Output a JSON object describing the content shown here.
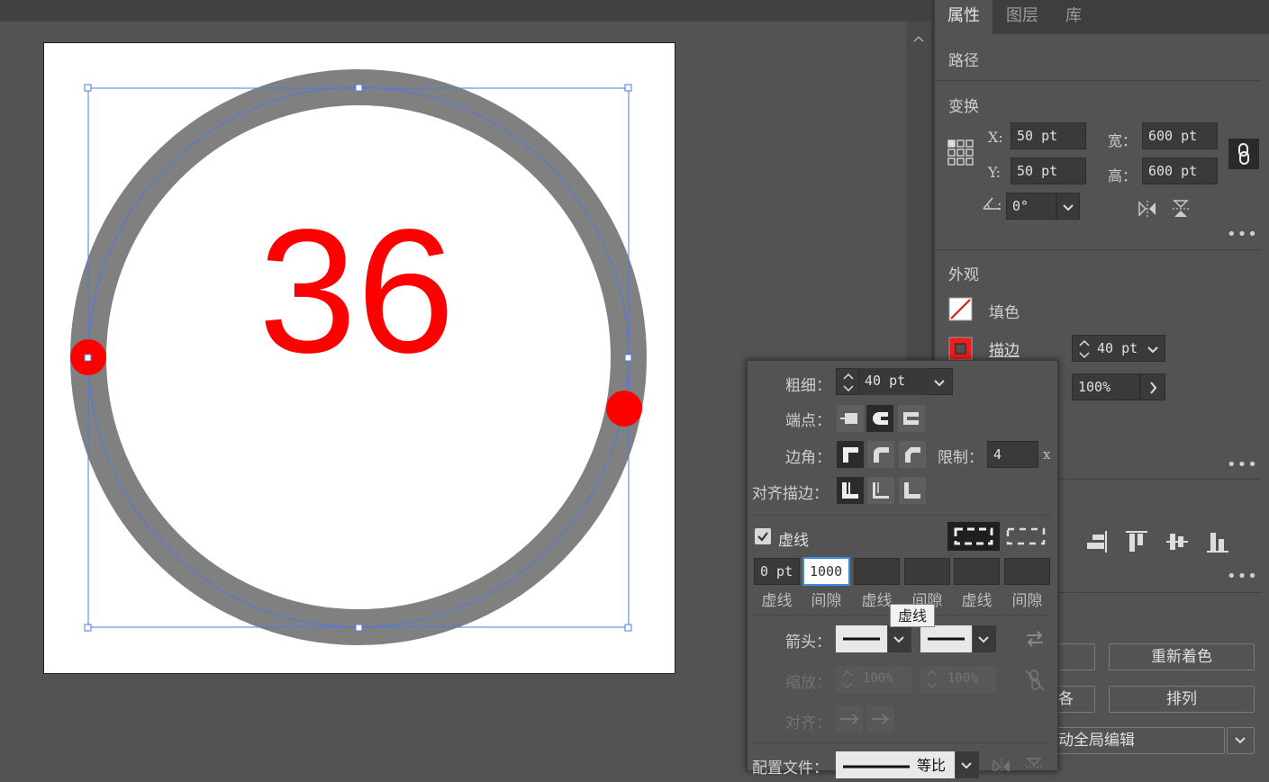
{
  "tabs": [
    {
      "label": "属性"
    },
    {
      "label": "图层"
    },
    {
      "label": "库"
    }
  ],
  "properties": {
    "object_type": "路径",
    "transform_title": "变换",
    "x_label": "X:",
    "x_value": "50 pt",
    "y_label": "Y:",
    "y_value": "50 pt",
    "width_label": "宽：",
    "width_value": "600 pt",
    "height_label": "高：",
    "height_value": "600 pt",
    "angle_value": "0°",
    "appearance_title": "外观",
    "fill_label": "填色",
    "stroke_label": "描边",
    "stroke_weight": "40 pt",
    "opacity_value": "100%",
    "recolor_button": "重新着色",
    "arrange_button": "排列",
    "partial_text_1": "各",
    "partial_text_2": "动全局编辑"
  },
  "artwork": {
    "number_text": "36",
    "number_color": "#ff0000",
    "ring_color": "#808080",
    "dot_color": "#ff0000",
    "selection_color": "#4a78e8"
  },
  "stroke_popup": {
    "weight_label": "粗细：",
    "weight_value": "40 pt",
    "cap_label": "端点：",
    "corner_label": "边角：",
    "limit_label": "限制：",
    "limit_value": "4",
    "limit_unit": "x",
    "align_label": "对齐描边：",
    "dashed_label": "虚线",
    "dashed_checked": true,
    "dash_values": [
      "0 pt",
      "1000",
      "",
      "",
      "",
      ""
    ],
    "dash_sublabels": [
      "虚线",
      "间隙",
      "虚线",
      "间隙",
      "虚线",
      "间隙"
    ],
    "tooltip": "虚线",
    "arrow_label": "箭头：",
    "scale_label": "缩放：",
    "scale_value_1": "100%",
    "scale_value_2": "100%",
    "align2_label": "对齐：",
    "profile_label": "配置文件：",
    "profile_value": "等比"
  }
}
